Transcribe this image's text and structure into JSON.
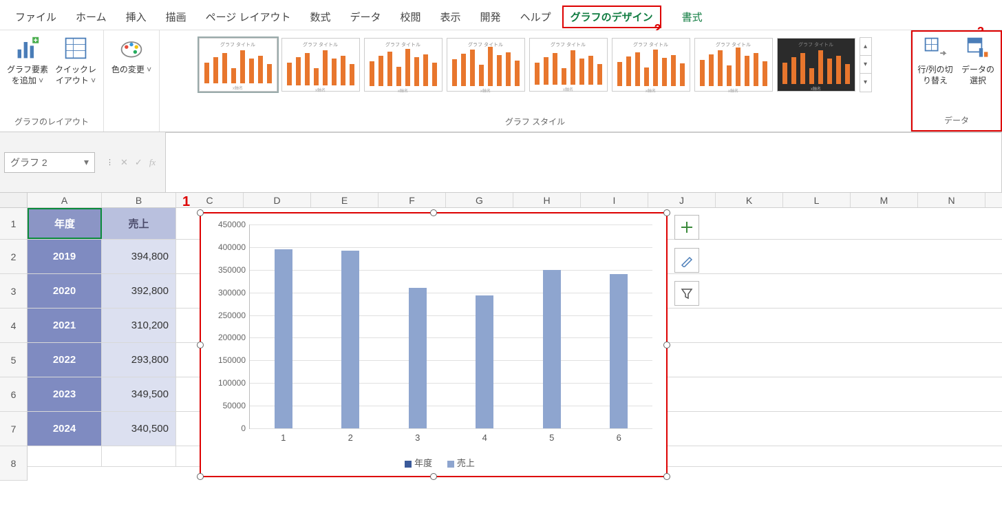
{
  "tabs": {
    "file": "ファイル",
    "home": "ホーム",
    "insert": "挿入",
    "draw": "描画",
    "layout": "ページ レイアウト",
    "formulas": "数式",
    "data": "データ",
    "review": "校閲",
    "view": "表示",
    "developer": "開発",
    "help": "ヘルプ",
    "chartdesign": "グラフのデザイン",
    "format": "書式"
  },
  "callouts": {
    "c1": "1",
    "c2": "2",
    "c3": "3"
  },
  "ribbon": {
    "layout_group": "グラフのレイアウト",
    "add_element": "グラフ要素を追加",
    "quick_layout": "クイックレイアウト",
    "colors": "色の変更",
    "styles_group": "グラフ スタイル",
    "thumb_title": "グラフ タイトル",
    "thumb_axis": "x軸名",
    "row_col": "行/列の切り替え",
    "select_data": "データの選択",
    "data_group": "データ"
  },
  "namebox": "グラフ 2",
  "table": {
    "headers": {
      "year": "年度",
      "sales": "売上"
    },
    "rows": [
      {
        "year": "2019",
        "sales": "394,800"
      },
      {
        "year": "2020",
        "sales": "392,800"
      },
      {
        "year": "2021",
        "sales": "310,200"
      },
      {
        "year": "2022",
        "sales": "293,800"
      },
      {
        "year": "2023",
        "sales": "349,500"
      },
      {
        "year": "2024",
        "sales": "340,500"
      }
    ]
  },
  "columns": [
    "A",
    "B",
    "C",
    "D",
    "E",
    "F",
    "G",
    "H",
    "I",
    "J",
    "K",
    "L",
    "M",
    "N"
  ],
  "rows": [
    "1",
    "2",
    "3",
    "4",
    "5",
    "6",
    "7",
    "8"
  ],
  "chart_data": {
    "type": "bar",
    "categories": [
      "1",
      "2",
      "3",
      "4",
      "5",
      "6"
    ],
    "series": [
      {
        "name": "年度",
        "values": []
      },
      {
        "name": "売上",
        "values": [
          394800,
          392800,
          310200,
          293800,
          349500,
          340500
        ]
      }
    ],
    "ylim": [
      0,
      450000
    ],
    "ystep": 50000,
    "ylabel": "",
    "xlabel": "",
    "title": "",
    "legend": [
      "年度",
      "売上"
    ],
    "yticks": [
      "0",
      "50000",
      "100000",
      "150000",
      "200000",
      "250000",
      "300000",
      "350000",
      "400000",
      "450000"
    ]
  }
}
